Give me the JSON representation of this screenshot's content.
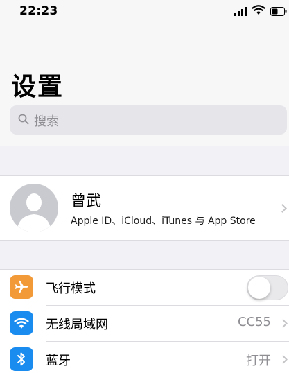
{
  "status_bar": {
    "time": "22:23",
    "signal_icon": "cellular-signal-icon",
    "wifi_icon": "wifi-icon",
    "battery_icon": "battery-icon"
  },
  "header": {
    "title": "设置",
    "search": {
      "placeholder": "搜索",
      "icon": "search-icon"
    }
  },
  "profile": {
    "name": "曾武",
    "subtitle": "Apple ID、iCloud、iTunes 与 App Store",
    "avatar_icon": "avatar-silhouette-icon"
  },
  "settings": [
    {
      "label": "飞行模式",
      "icon": "airplane-icon",
      "icon_color": "#f19a37",
      "type": "toggle",
      "enabled": false
    },
    {
      "label": "无线局域网",
      "icon": "wifi-icon",
      "icon_color": "#1a8cf0",
      "type": "value",
      "value": "CC55"
    },
    {
      "label": "蓝牙",
      "icon": "bluetooth-icon",
      "icon_color": "#1a8cf0",
      "type": "value",
      "value": "打开"
    }
  ],
  "colors": {
    "background": "#f2f2f6",
    "card": "#ffffff",
    "secondary_text": "#8e8e93",
    "separator": "#dcdce0"
  }
}
